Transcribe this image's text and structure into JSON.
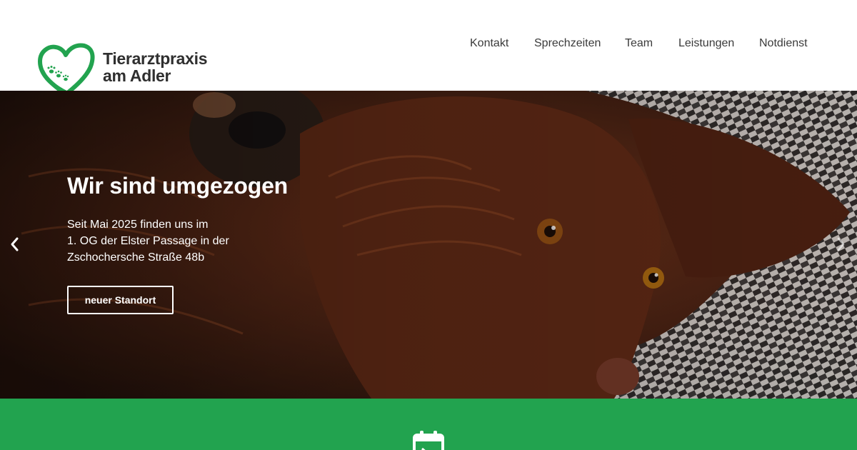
{
  "header": {
    "logo": {
      "line1": "Tierarztpraxis",
      "line2": "am Adler",
      "icon": "heart-paw-icon"
    },
    "nav": [
      {
        "label": "Kontakt"
      },
      {
        "label": "Sprechzeiten"
      },
      {
        "label": "Team"
      },
      {
        "label": "Leistungen"
      },
      {
        "label": "Notdienst"
      }
    ]
  },
  "hero": {
    "title": "Wir sind umgezogen",
    "text_lines": [
      "Seit Mai 2025 finden uns im",
      "1. OG der Elster Passage in der",
      "Zschochersche Straße 48b"
    ],
    "button_label": "neuer Standort",
    "prev_icon": "chevron-left-icon",
    "next_icon": "chevron-right-icon"
  },
  "band": {
    "icon": "calendar-icon"
  },
  "colors": {
    "brand_green": "#22a34f",
    "text_dark": "#2f2f2f",
    "nav_text": "#3a3a3a"
  }
}
